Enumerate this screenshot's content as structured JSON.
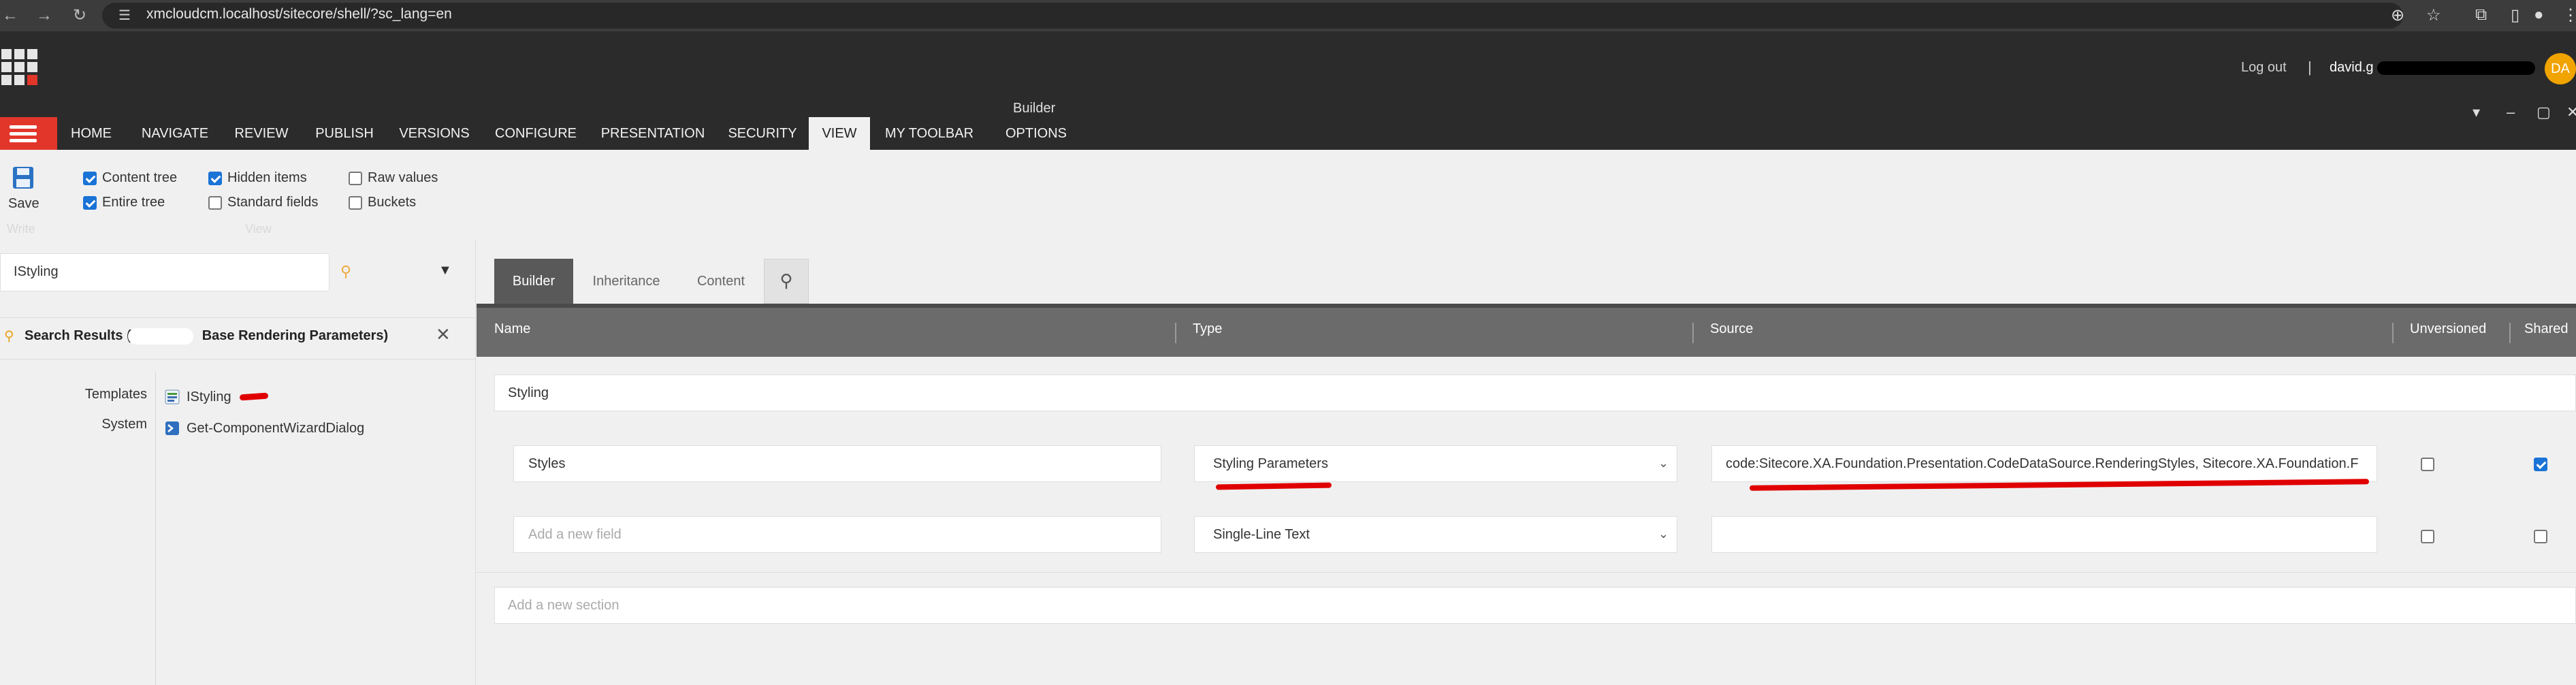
{
  "browser": {
    "url": "xmcloudcm.localhost/sitecore/shell/?sc_lang=en"
  },
  "header": {
    "logout": "Log out",
    "separator": "|",
    "user": "david.g",
    "avatar_initials": "DA"
  },
  "window": {
    "title": "Builder"
  },
  "ribbon": {
    "tabs": [
      "HOME",
      "NAVIGATE",
      "REVIEW",
      "PUBLISH",
      "VERSIONS",
      "CONFIGURE",
      "PRESENTATION",
      "SECURITY",
      "VIEW",
      "MY TOOLBAR",
      "OPTIONS"
    ],
    "active_tab": "VIEW",
    "save_label": "Save",
    "checkboxes": [
      {
        "label": "Content tree",
        "checked": true
      },
      {
        "label": "Entire tree",
        "checked": true
      },
      {
        "label": "Hidden items",
        "checked": true
      },
      {
        "label": "Standard fields",
        "checked": false
      },
      {
        "label": "Raw values",
        "checked": false
      },
      {
        "label": "Buckets",
        "checked": false
      }
    ],
    "group_labels": [
      "Write",
      "View"
    ]
  },
  "left": {
    "search_value": "IStyling",
    "results_label": "Search Results (",
    "results_suffix": "Base Rendering Parameters)",
    "groups": [
      {
        "label": "Templates",
        "item": "IStyling"
      },
      {
        "label": "System",
        "item": "Get-ComponentWizardDialog"
      }
    ]
  },
  "builder": {
    "tabs": [
      "Builder",
      "Inheritance",
      "Content"
    ],
    "active_tab": "Builder",
    "columns": [
      "Name",
      "Type",
      "Source",
      "Unversioned",
      "Shared"
    ],
    "section_name": "Styling",
    "rows": [
      {
        "name": "Styles",
        "type": "Styling Parameters",
        "source": "code:Sitecore.XA.Foundation.Presentation.CodeDataSource.RenderingStyles, Sitecore.XA.Foundation.F",
        "unversioned": false,
        "shared": true
      },
      {
        "name_placeholder": "Add a new field",
        "type": "Single-Line Text",
        "source": "",
        "unversioned": false,
        "shared": false
      }
    ],
    "add_section_placeholder": "Add a new section"
  },
  "colors": {
    "accent_red": "#e2362b",
    "avatar": "#f1a300",
    "checkbox_blue": "#1a73d6"
  }
}
